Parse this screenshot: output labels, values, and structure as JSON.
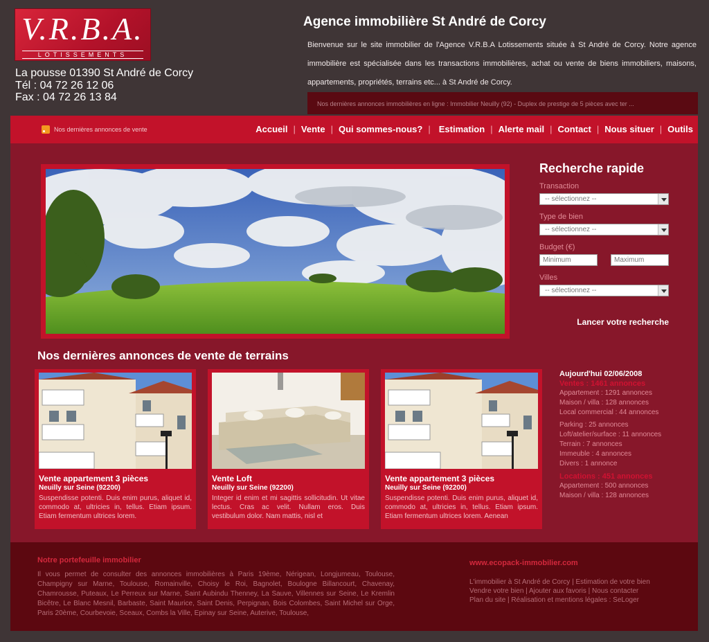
{
  "header": {
    "logo_main": "V.R.B.A.",
    "logo_sub": "LOTISSEMENTS",
    "address_line1": "La pousse 01390 St André de Corcy",
    "address_line2": "Tél : 04 72  26 12 06",
    "address_line3": "Fax : 04 72 26 13 84",
    "title": "Agence immobilière St André de Corcy",
    "intro": "Bienvenue sur le site immobilier de l'Agence V.R.B.A Lotissements située à St André de Corcy. Notre agence immobilière est spécialisée dans les transactions immobilières, achat ou vente de biens immobiliers, maisons, appartements, propriétés, terrains etc... à St André de Corcy.",
    "ticker": "Nos dernières annonces immobilières en ligne : Immobilier Neuilly (92) - Duplex de prestige de 5 pièces avec ter ..."
  },
  "nav": {
    "rss_label": "Nos dernières annonces de vente",
    "items": [
      "Accueil",
      "Vente",
      "Qui sommes-nous?",
      "Estimation",
      "Alerte mail",
      "Contact",
      "Nous situer",
      "Outils"
    ]
  },
  "search": {
    "title": "Recherche rapide",
    "transaction_label": "Transaction",
    "transaction_value": "-- sélectionnez --",
    "type_label": "Type de bien",
    "type_value": "-- sélectionnez --",
    "budget_label": "Budget (€)",
    "min_placeholder": "Minimum",
    "max_placeholder": "Maximum",
    "villes_label": "Villes",
    "villes_value": "-- sélectionnez --",
    "submit": "Lancer votre recherche"
  },
  "listings": {
    "title": "Nos dernières annonces  de vente de terrains",
    "cards": [
      {
        "title": "Vente appartement 3 pièces",
        "location": "Neuilly sur Seine (92200)",
        "desc": "Suspendisse potenti. Duis enim purus, aliquet id, commodo at, ultricies in, tellus. Etiam ipsum. Etiam fermentum ultrices lorem."
      },
      {
        "title": "Vente Loft",
        "location": "Neuilly sur Seine (92200)",
        "desc": "Integer id enim et mi sagittis sollicitudin. Ut vitae lectus. Cras ac velit. Nullam eros. Duis vestibulum dolor. Nam mattis, nisl et"
      },
      {
        "title": "Vente appartement 3 pièces",
        "location": "Neuilly sur Seine (92200)",
        "desc": "Suspendisse potenti. Duis enim purus, aliquet id, commodo at, ultricies in, tellus. Etiam ipsum. Etiam fermentum ultrices lorem. Aenean"
      }
    ]
  },
  "stats": {
    "date": "Aujourd'hui 02/06/2008",
    "ventes_header": "Ventes : 1461 annonces",
    "ventes": [
      "Appartement : 1291 annonces",
      "Maison / villa : 128 annonces",
      "Local commercial : 44 annonces"
    ],
    "ventes2": [
      "Parking : 25 annonces",
      "Loft/atelier/surface : 11 annonces",
      "Terrain : 7 annonces",
      "Immeuble : 4 annonces",
      "Divers : 1 annonce"
    ],
    "locations_header": "Locations : 451 annonces",
    "locations": [
      "Appartement : 500 annonces",
      "Maison / villa : 128 annonces"
    ]
  },
  "footer": {
    "title": "Notre portefeuille immobilier",
    "text": "Il vous permet de consulter des annonces immobilières à Paris 19ème, Nérigean, Longjumeau, Toulouse, Champigny sur Marne, Toulouse, Romainville, Choisy le Roi, Bagnolet, Boulogne Billancourt, Chavenay, Chamrousse, Puteaux, Le Perreux sur Marne, Saint Aubindu Thenney, La Sauve, Villennes sur Seine, Le Kremlin Bicêtre, Le Blanc Mesnil, Barbaste, Saint Maurice, Saint Denis, Perpignan, Bois Colombes, Saint Michel sur Orge, Paris 20ème, Courbevoie, Sceaux, Combs la Ville, Epinay sur Seine, Auterive, Toulouse,",
    "url": "www.ecopack-immobilier.com",
    "link1": "L'immobilier à St André de Corcy",
    "link2": "Estimation de votre bien",
    "link3": "Vendre votre bien",
    "link4": "Ajouter aux favoris",
    "link5": "Nous contacter",
    "link6": "Plan du site",
    "link7": "Réalisation et mentions légales : SeLoger"
  }
}
